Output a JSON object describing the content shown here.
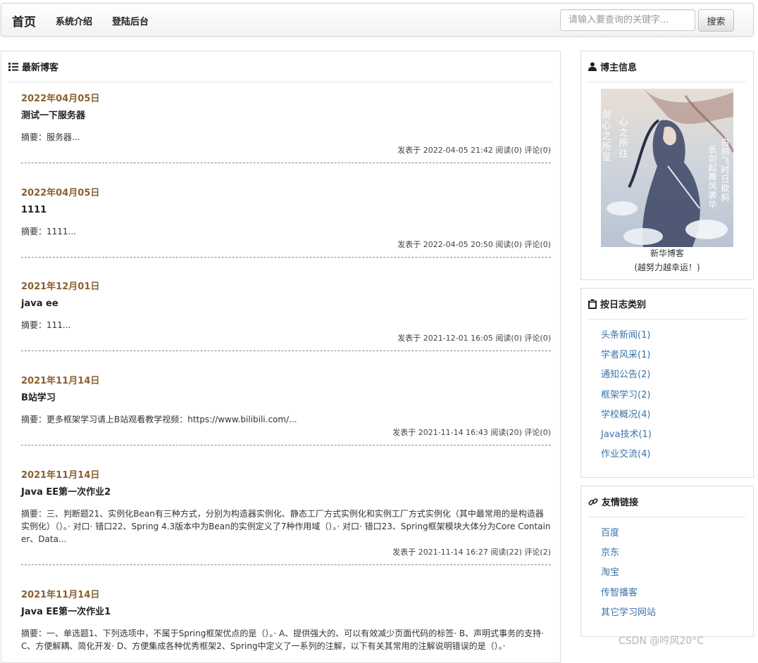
{
  "navbar": {
    "brand": "首页",
    "links": [
      "系统介绍",
      "登陆后台"
    ],
    "search_placeholder": "请输入要查询的关键字...",
    "search_button": "搜索"
  },
  "blog_panel": {
    "title": "最新博客",
    "posts": [
      {
        "date": "2022年04月05日",
        "title": "测试一下服务器",
        "summary": "摘要：服务器...",
        "meta": "发表于 2022-04-05 21:42 阅读(0) 评论(0)"
      },
      {
        "date": "2022年04月05日",
        "title": "1111",
        "summary": "摘要：1111...",
        "meta": "发表于 2022-04-05 20:50 阅读(0) 评论(0)"
      },
      {
        "date": "2021年12月01日",
        "title": "java ee",
        "summary": "摘要：111...",
        "meta": "发表于 2021-12-01 16:05 阅读(0) 评论(0)"
      },
      {
        "date": "2021年11月14日",
        "title": "B站学习",
        "summary": "摘要：更多框架学习请上B站观看教学视频：https://www.bilibili.com/...",
        "meta": "发表于 2021-11-14 16:43 阅读(20) 评论(0)"
      },
      {
        "date": "2021年11月14日",
        "title": "Java EE第一次作业2",
        "summary": "摘要：三、判断题21、实例化Bean有三种方式，分别为构造器实例化、静态工厂方式实例化和实例工厂方式实例化（其中最常用的是构造器实例化）（）。· 对口· 错口22、Spring 4.3版本中为Bean的实例定义了7种作用域（）。· 对口· 错口23、Spring框架模块大体分为Core Container、Data...",
        "meta": "发表于 2021-11-14 16:27 阅读(22) 评论(2)"
      },
      {
        "date": "2021年11月14日",
        "title": "Java EE第一次作业1",
        "summary": "摘要：一、单选题1、下列选项中，不属于Spring框架优点的是（）。· A、提供强大的、可以有效减少页面代码的标签· B、声明式事务的支持· C、方便解耦、简化开发· D、方便集成各种优秀框架2、Spring中定义了一系列的注解，以下有关其常用的注解说明错误的是（）。·",
        "meta": ""
      }
    ]
  },
  "blogger_panel": {
    "title": "博主信息",
    "name": "新华博客",
    "motto": "(越努力越幸运！)",
    "avatar_text_left": "剑心之所至",
    "avatar_text_mid": "心之所往",
    "avatar_text_right1": "白鸽飞时日欲斜",
    "avatar_text_right2": "长剑起舞风袭华"
  },
  "category_panel": {
    "title": "按日志类别",
    "items": [
      "头条新闻(1)",
      "学者风采(1)",
      "通知公告(2)",
      "框架学习(2)",
      "学校概况(4)",
      "Java技术(1)",
      "作业交流(4)"
    ]
  },
  "links_panel": {
    "title": "友情链接",
    "items": [
      "百度",
      "京东",
      "淘宝",
      "传智播客",
      "其它学习网站"
    ]
  },
  "watermark": "CSDN @吟风20°C",
  "colors": {
    "date": "#8a6030",
    "link": "#3a73a8"
  }
}
